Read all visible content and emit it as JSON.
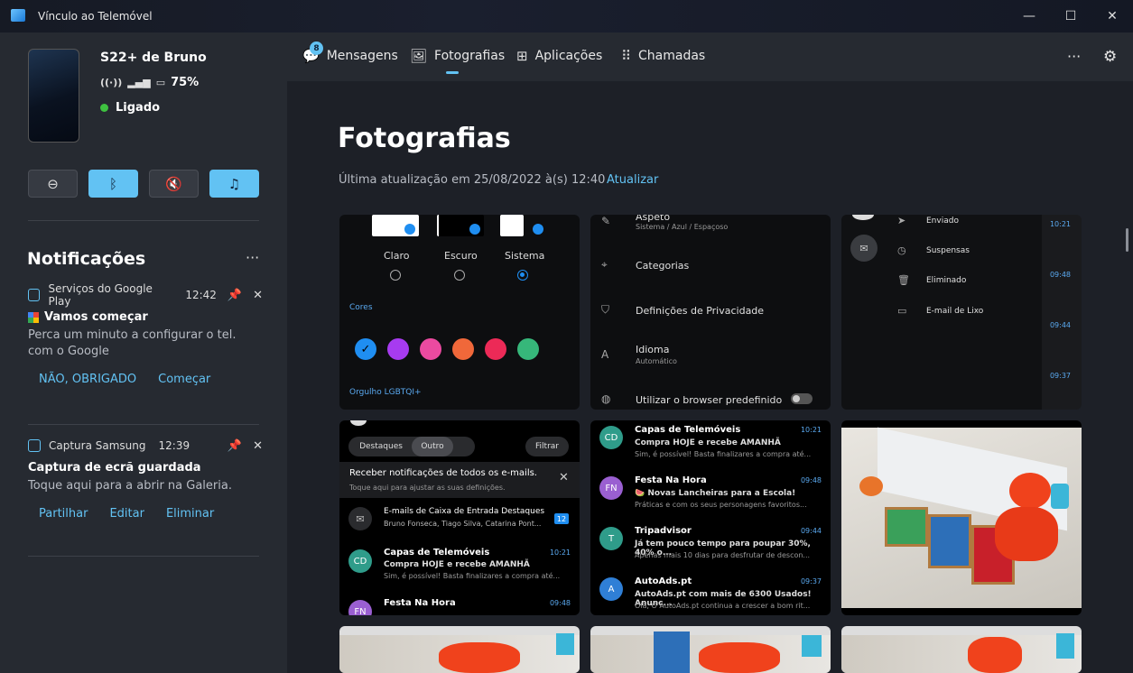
{
  "window": {
    "title": "Vínculo ao Telemóvel",
    "minimize": "—",
    "maximize": "☐",
    "close": "✕"
  },
  "device": {
    "name": "S22+ de Bruno",
    "battery": "75%",
    "status": "Ligado"
  },
  "quick_actions": [
    {
      "icon": "do-not-disturb-icon",
      "glyph": "⊖",
      "active": false
    },
    {
      "icon": "bluetooth-icon",
      "glyph": "ᛒ",
      "active": true
    },
    {
      "icon": "mute-icon",
      "glyph": "🔇",
      "active": false
    },
    {
      "icon": "music-icon",
      "glyph": "♫",
      "active": true
    }
  ],
  "notifications": {
    "title": "Notificações",
    "more": "···",
    "items": [
      {
        "app": "Serviços do Google Play",
        "time": "12:42",
        "heading": "Vamos começar",
        "body": "Perca um minuto a configurar o tel. com o Google",
        "actions": [
          "NÃO, OBRIGADO",
          "Começar"
        ]
      },
      {
        "app": "Captura Samsung",
        "time": "12:39",
        "heading": "Captura de ecrã guardada",
        "body": "Toque aqui para a abrir na Galeria.",
        "actions": [
          "Partilhar",
          "Editar",
          "Eliminar"
        ]
      }
    ]
  },
  "tabs": [
    {
      "label": "Mensagens",
      "icon": "messages-icon",
      "glyph": "💬",
      "badge": "8"
    },
    {
      "label": "Fotografias",
      "icon": "photos-icon",
      "glyph": "🖼",
      "active": true
    },
    {
      "label": "Aplicações",
      "icon": "apps-icon",
      "glyph": "⊞"
    },
    {
      "label": "Chamadas",
      "icon": "calls-icon",
      "glyph": "⠿"
    }
  ],
  "header_actions": {
    "more": "···",
    "settings": "⚙"
  },
  "page": {
    "title": "Fotografias",
    "updated": "Última atualização em 25/08/2022 à(s) 12:40",
    "refresh": "Atualizar"
  },
  "shot1": {
    "themes": [
      "Claro",
      "Escuro",
      "Sistema"
    ],
    "cores": "Cores",
    "orgulho": "Orgulho LGBTQI+",
    "colors": [
      "#1f8ef1",
      "#a73bf0",
      "#ec4aa0",
      "#f0683a",
      "#ec2a57",
      "#36b77a"
    ]
  },
  "shot2": {
    "aspect_title": "Aspeto",
    "aspect_sub": "Sistema / Azul / Espaçoso",
    "categorias": "Categorias",
    "privacidade": "Definições de Privacidade",
    "idioma": "Idioma",
    "idioma_sub": "Automático",
    "browser": "Utilizar o browser predefinido"
  },
  "shot3": {
    "items": [
      "Enviado",
      "Suspensas",
      "Eliminado",
      "E-mail de Lixo"
    ],
    "times": [
      "10:21",
      "09:48",
      "09:44",
      "09:37"
    ]
  },
  "shot4": {
    "tabs": [
      "Destaques",
      "Outro"
    ],
    "filter": "Filtrar",
    "banner_title": "Receber notificações de todos os e-mails.",
    "banner_sub": "Toque aqui para ajustar as suas definições.",
    "focused_title": "E-mails de Caixa de Entrada Destaques",
    "focused_sub": "Bruno Fonseca, Tiago Silva, Catarina Pont...",
    "focused_count": "12",
    "mail1": {
      "av": "CD",
      "from": "Capas de Telemóveis",
      "time": "10:21",
      "subj": "Compra HOJE e recebe AMANHÃ",
      "prev": "Sim, é possível! Basta finalizares a compra até..."
    },
    "mail2": {
      "av": "FN",
      "from": "Festa Na Hora",
      "time": "09:48"
    }
  },
  "shot5": [
    {
      "av": "CD",
      "color": "#2f9c8a",
      "from": "Capas de Telemóveis",
      "time": "10:21",
      "subj": "Compra HOJE e recebe AMANHÃ",
      "prev": "Sim, é possível! Basta finalizares a compra até..."
    },
    {
      "av": "FN",
      "color": "#9a5fd1",
      "from": "Festa Na Hora",
      "time": "09:48",
      "subj": "🍉 Novas Lancheiras para a Escola!",
      "prev": "Práticas e com os seus personagens favoritos..."
    },
    {
      "av": "T",
      "color": "#2f9c8a",
      "from": "Tripadvisor",
      "time": "09:44",
      "subj": "Já tem pouco tempo para poupar 30%, 40% o...",
      "prev": "Apenas mais 10 dias para desfrutar de descon..."
    },
    {
      "av": "A",
      "color": "#2f7fd6",
      "from": "AutoAds.pt",
      "time": "09:37",
      "subj": "AutoAds.pt com mais de 6300 Usados! Anunc...",
      "prev": "Olá, O AutoAds.pt continua a crescer a bom rit..."
    }
  ]
}
